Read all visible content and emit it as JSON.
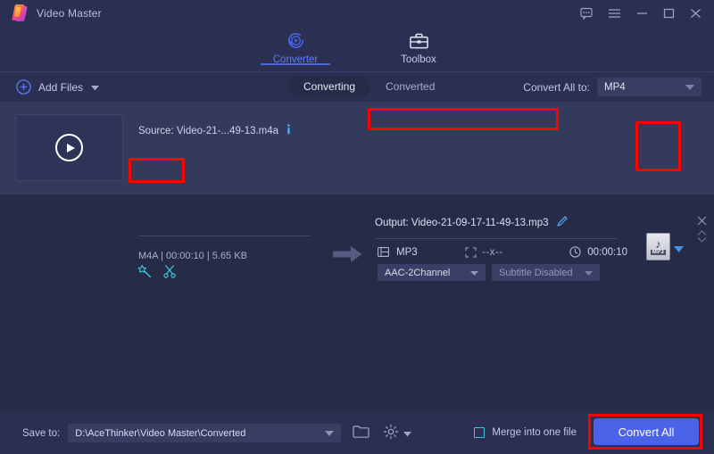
{
  "window": {
    "app_title": "Video Master",
    "controls": [
      {
        "name": "feedback-icon",
        "label": "feedback"
      },
      {
        "name": "menu-icon",
        "label": "menu"
      },
      {
        "name": "minimize-icon",
        "label": "minimize"
      },
      {
        "name": "maximize-icon",
        "label": "maximize"
      },
      {
        "name": "close-icon",
        "label": "close"
      }
    ]
  },
  "nav": {
    "tabs": [
      {
        "label": "Converter",
        "icon": "converter-icon",
        "active": true
      },
      {
        "label": "Toolbox",
        "icon": "toolbox-icon",
        "active": false
      }
    ]
  },
  "toolbar": {
    "add_files_label": "Add Files",
    "segments": [
      {
        "label": "Converting",
        "active": true
      },
      {
        "label": "Converted",
        "active": false
      }
    ],
    "convert_all_to_label": "Convert All to:",
    "convert_all_to_value": "MP4"
  },
  "file": {
    "source_label": "Source: Video-21-...49-13.m4a",
    "meta": "M4A |  00:00:10 | 5.65 KB",
    "output_label": "Output: Video-21-09-17-11-49-13.mp3",
    "format": "MP3",
    "resolution": "--x--",
    "duration": "00:00:10",
    "audio_channel": "AAC-2Channel",
    "subtitle": "Subtitle Disabled",
    "format_badge": "MP3",
    "format_badge_note": "♪"
  },
  "bottom": {
    "save_to_label": "Save to:",
    "save_to_path": "D:\\AceThinker\\Video Master\\Converted",
    "merge_label": "Merge into one file",
    "convert_all_label": "Convert All"
  },
  "colors": {
    "accent": "#4a63e8",
    "highlight": "#fe0000",
    "cyan": "#3ec6e0",
    "panel": "#343a5c",
    "background": "#2b3053"
  }
}
